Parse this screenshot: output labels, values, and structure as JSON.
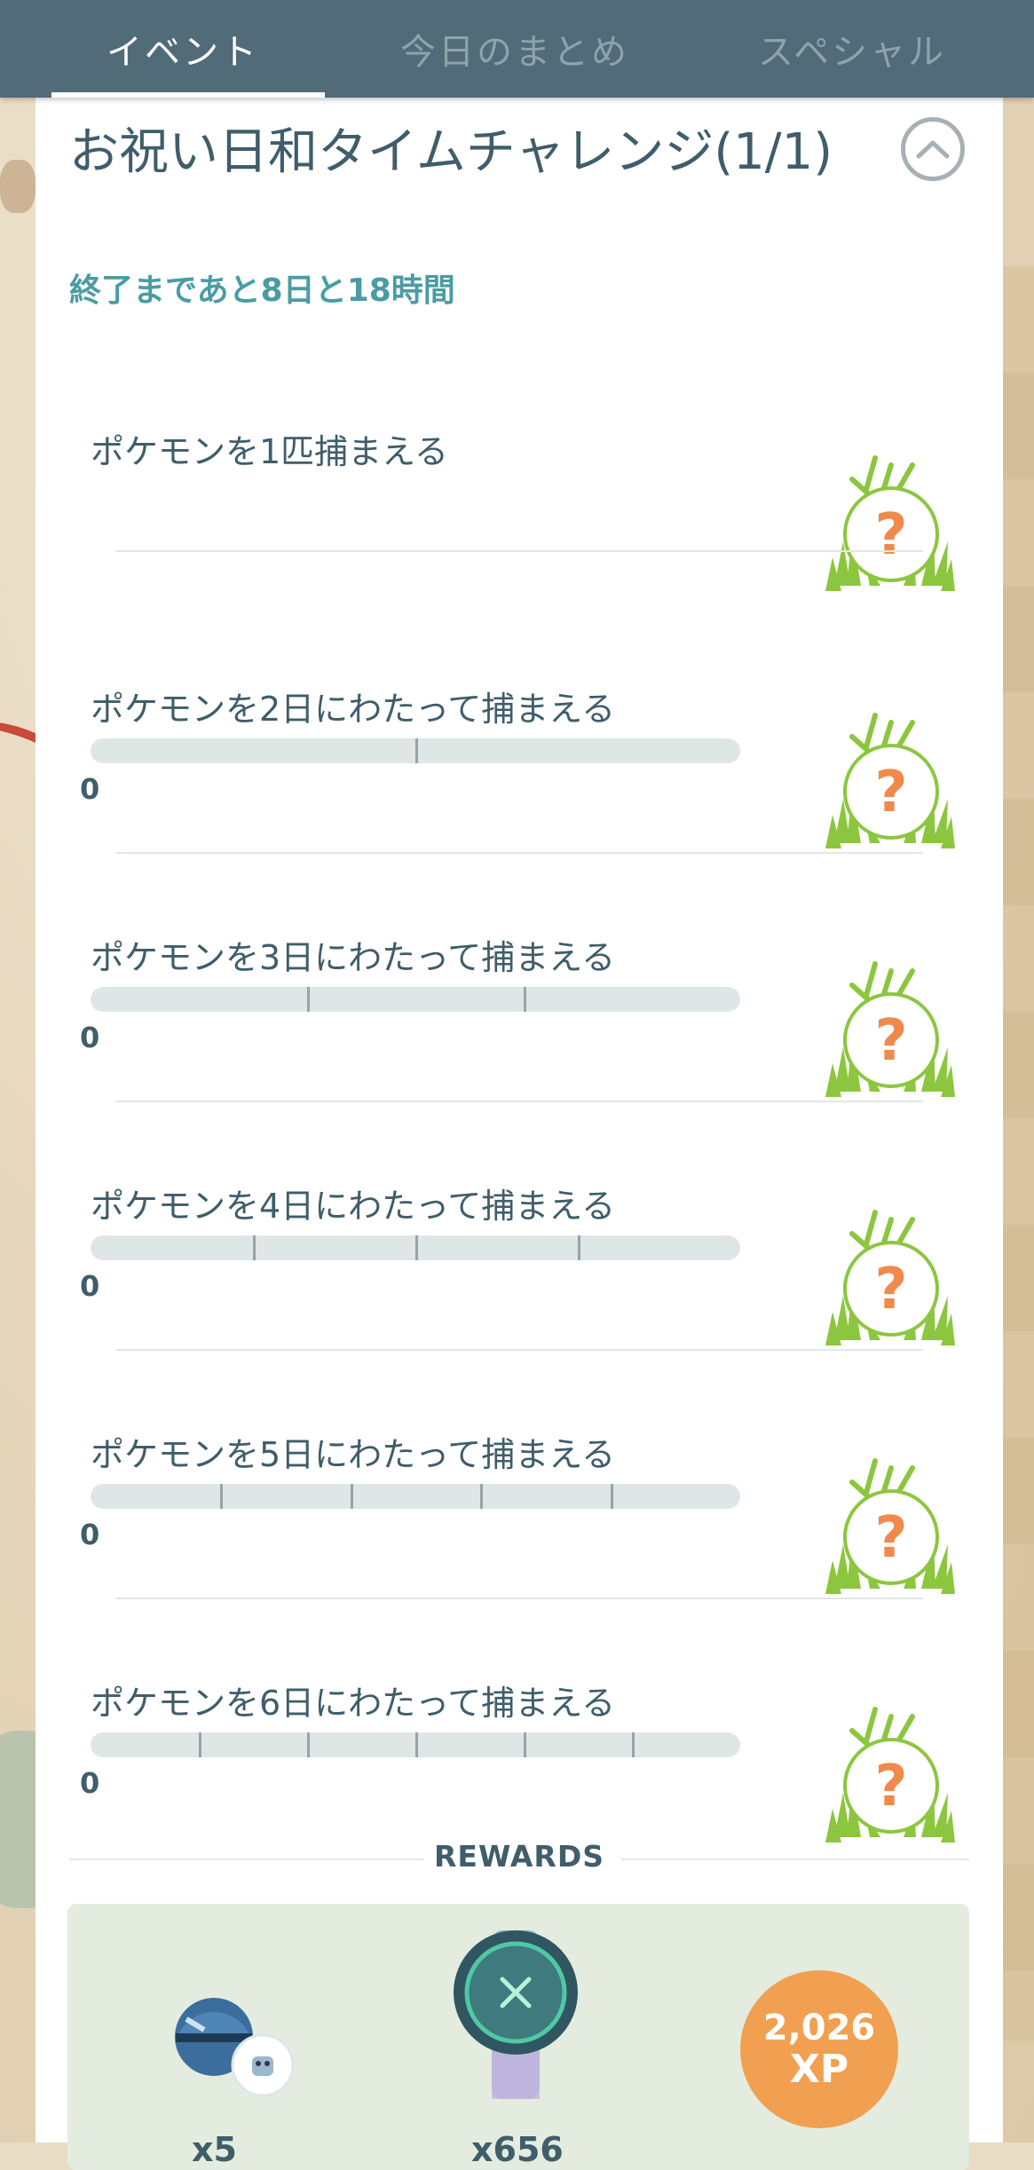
{
  "tabs": [
    {
      "label": "イベント",
      "active": true
    },
    {
      "label": "今日のまとめ",
      "active": false
    },
    {
      "label": "スペシャル",
      "active": false
    }
  ],
  "challenge": {
    "title": "お祝い日和タイムチャレンジ(1/1)",
    "countdown": "終了まであと8日と18時間"
  },
  "tasks": [
    {
      "label": "ポケモンを1匹捕まえる",
      "progress_shown": false,
      "reward_icon": "mystery-encounter-icon"
    },
    {
      "label": "ポケモンを2日にわたって捕まえる",
      "progress": 0,
      "total": 2,
      "count_text": "0",
      "reward_icon": "mystery-encounter-icon"
    },
    {
      "label": "ポケモンを3日にわたって捕まえる",
      "progress": 0,
      "total": 3,
      "count_text": "0",
      "reward_icon": "mystery-encounter-icon"
    },
    {
      "label": "ポケモンを4日にわたって捕まえる",
      "progress": 0,
      "total": 4,
      "count_text": "0",
      "reward_icon": "mystery-encounter-icon"
    },
    {
      "label": "ポケモンを5日にわたって捕まえる",
      "progress": 0,
      "total": 5,
      "count_text": "0",
      "reward_icon": "mystery-encounter-icon"
    },
    {
      "label": "ポケモンを6日にわたって捕まえる",
      "progress": 0,
      "total": 6,
      "count_text": "0",
      "reward_icon": "mystery-encounter-icon"
    }
  ],
  "rewards": {
    "heading": "REWARDS",
    "items": [
      {
        "icon": "great-ball-icon",
        "count": "x5"
      },
      {
        "icon": "incense-icon",
        "count": "x656"
      },
      {
        "icon": "xp-badge",
        "value": "2,026",
        "unit": "XP"
      }
    ]
  },
  "colors": {
    "tabbar": "#516b78",
    "title": "#3f5d6a",
    "countdown": "#4a9ca3",
    "grass": "#8cc63f",
    "question": "#f08a4b",
    "xp_badge": "#f0a050"
  }
}
